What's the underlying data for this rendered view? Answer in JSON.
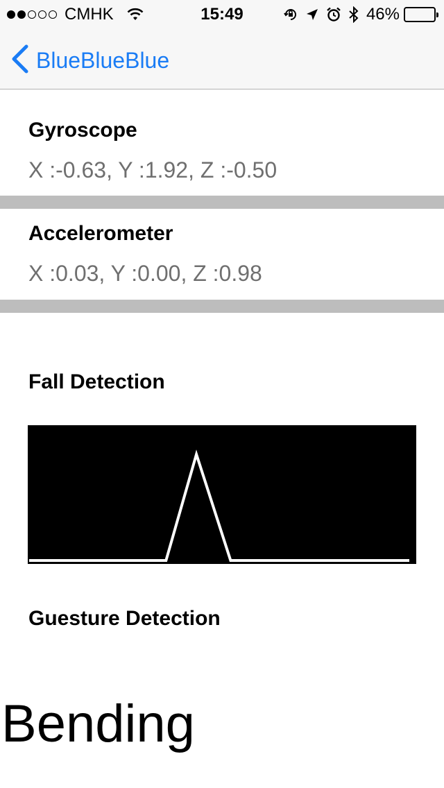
{
  "status_bar": {
    "signal_dots": [
      1,
      1,
      0,
      0,
      0
    ],
    "carrier": "CMHK",
    "time": "15:49",
    "battery_percent_text": "46%",
    "battery_level": 0.46,
    "icons": [
      "wifi-icon",
      "orientation-lock-icon",
      "location-arrow-icon",
      "alarm-icon",
      "bluetooth-icon"
    ]
  },
  "nav": {
    "back_label": "BlueBlueBlue",
    "accent": "#1a7cf5"
  },
  "gyroscope": {
    "title": "Gyroscope",
    "value": "X :-0.63, Y :1.92, Z :-0.50"
  },
  "accelerometer": {
    "title": "Accelerometer",
    "value": "X :0.03, Y :0.00, Z :0.98"
  },
  "fall_detection": {
    "title": "Fall Detection"
  },
  "gesture_detection": {
    "title": "Guesture Detection",
    "result": "Bending"
  },
  "chart_data": {
    "type": "line",
    "x": [
      0,
      36,
      44,
      53,
      100
    ],
    "series": [
      {
        "values": [
          0,
          0,
          1,
          0,
          0
        ]
      }
    ],
    "ylim": [
      0,
      1
    ],
    "grid": false,
    "background": "#000000",
    "line_color": "#ffffff"
  }
}
